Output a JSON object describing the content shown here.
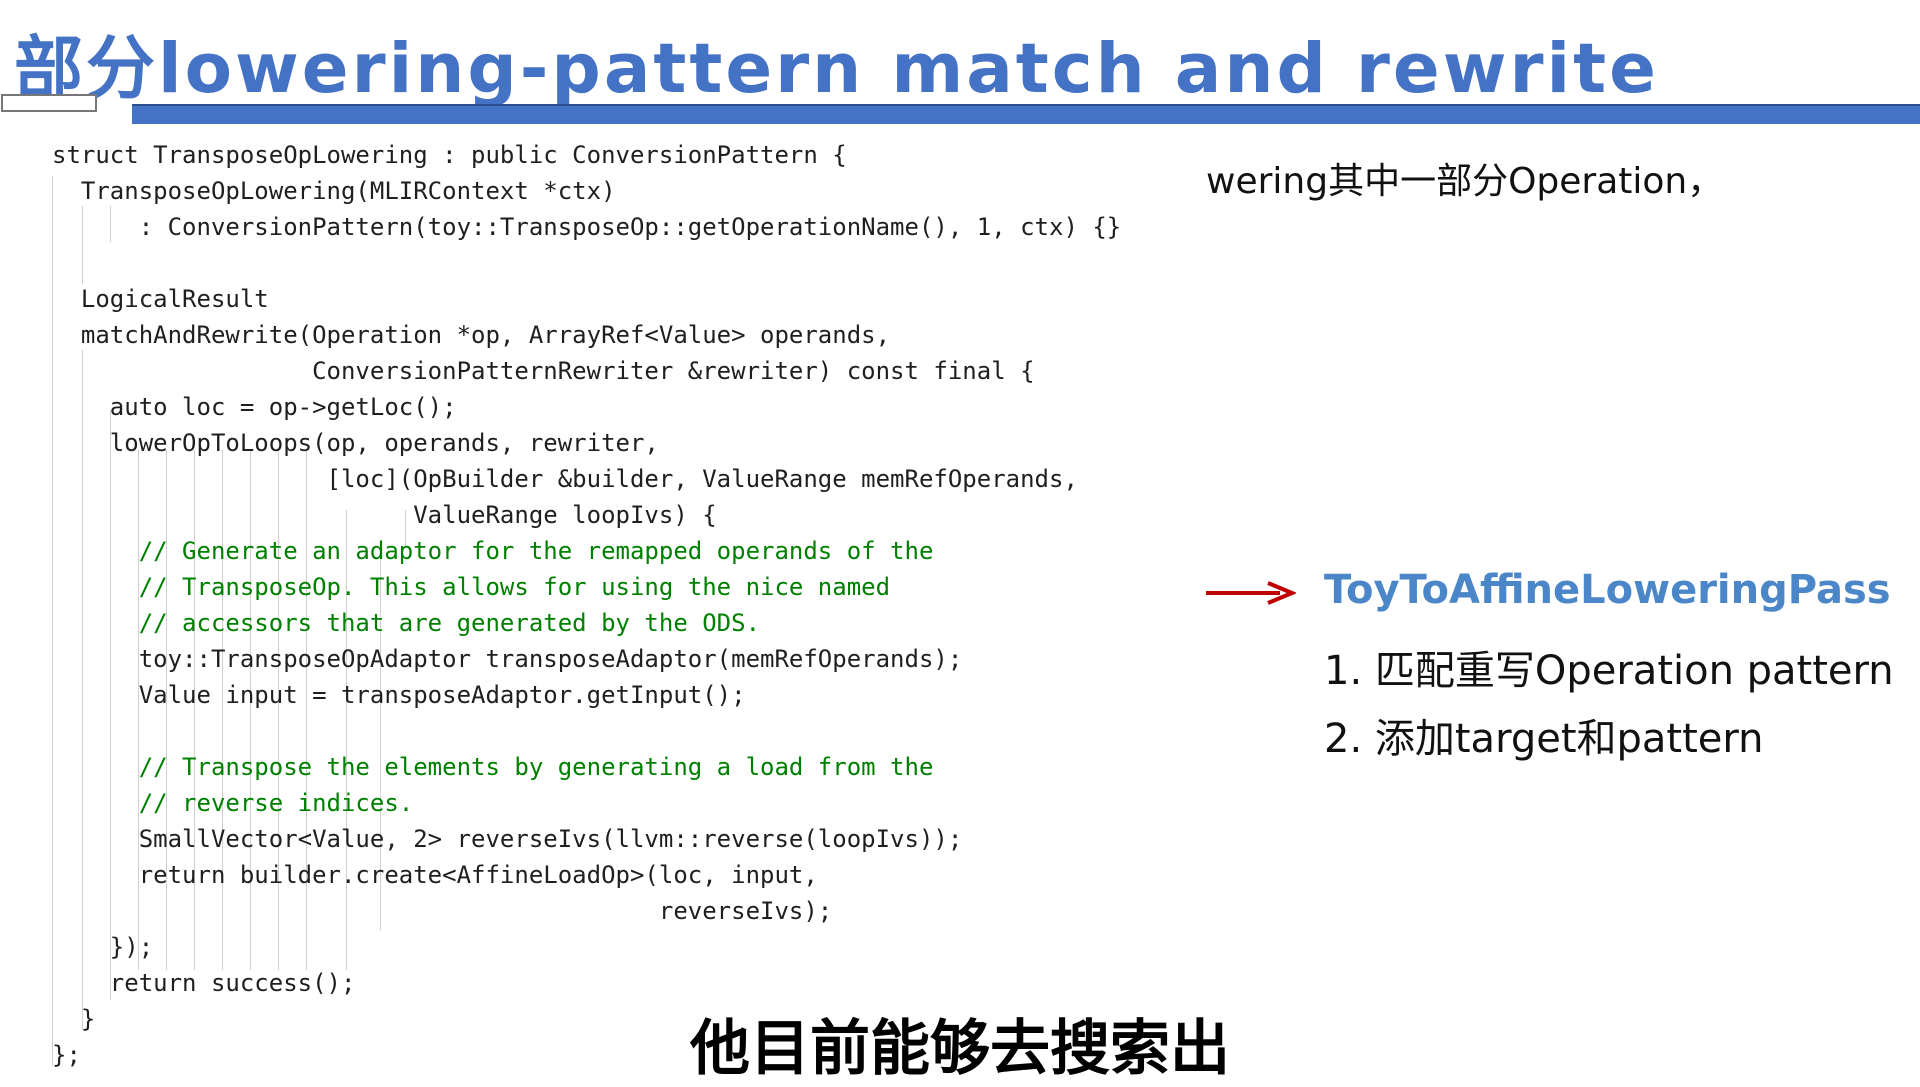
{
  "slide": {
    "title": "部分lowering-pattern match and rewrite",
    "note_top": "wering其中一部分Operation，",
    "pass_name": "ToyToAffineLoweringPass",
    "steps": [
      "1. 匹配重写Operation pattern",
      "2. 添加target和pattern"
    ],
    "subtitle": "他目前能够去搜索出"
  },
  "code": {
    "lines": [
      "struct TransposeOpLowering : public ConversionPattern {",
      "  TransposeOpLowering(MLIRContext *ctx)",
      "      : ConversionPattern(toy::TransposeOp::getOperationName(), 1, ctx) {}",
      "",
      "  LogicalResult",
      "  matchAndRewrite(Operation *op, ArrayRef<Value> operands,",
      "                  ConversionPatternRewriter &rewriter) const final {",
      "    auto loc = op->getLoc();",
      "    lowerOpToLoops(op, operands, rewriter,",
      "                   [loc](OpBuilder &builder, ValueRange memRefOperands,",
      "                         ValueRange loopIvs) {",
      "      // Generate an adaptor for the remapped operands of the",
      "      // TransposeOp. This allows for using the nice named",
      "      // accessors that are generated by the ODS.",
      "      toy::TransposeOpAdaptor transposeAdaptor(memRefOperands);",
      "      Value input = transposeAdaptor.getInput();",
      "",
      "      // Transpose the elements by generating a load from the",
      "      // reverse indices.",
      "      SmallVector<Value, 2> reverseIvs(llvm::reverse(loopIvs));",
      "      return builder.create<AffineLoadOp>(loc, input,",
      "                                          reverseIvs);",
      "    });",
      "    return success();",
      "  }",
      "};"
    ]
  },
  "colors": {
    "title": "#4472c4",
    "pass_name": "#4a86c8",
    "arrow": "#c00000",
    "keyword": "#0000d0",
    "type": "#267f99",
    "function": "#795e26",
    "comment": "#008000"
  }
}
